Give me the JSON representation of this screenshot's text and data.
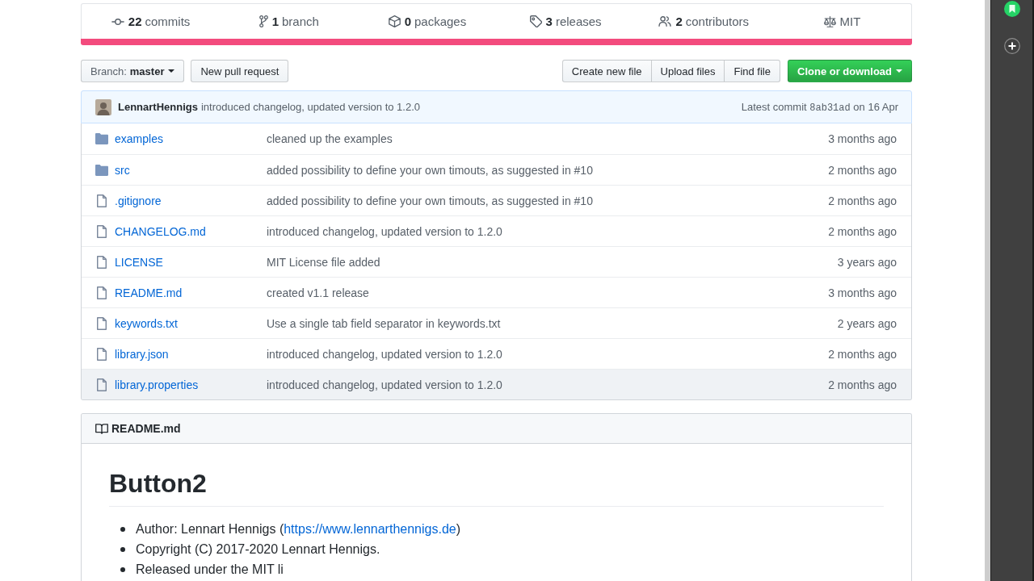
{
  "stats": [
    {
      "kind": "commits",
      "count": "22",
      "label": "commits"
    },
    {
      "kind": "branch",
      "count": "1",
      "label": "branch"
    },
    {
      "kind": "packages",
      "count": "0",
      "label": "packages"
    },
    {
      "kind": "releases",
      "count": "3",
      "label": "releases"
    },
    {
      "kind": "contributors",
      "count": "2",
      "label": "contributors"
    },
    {
      "kind": "license",
      "label": "MIT"
    }
  ],
  "toolbar": {
    "branch_select": {
      "label": "Branch:",
      "value": "master"
    },
    "new_pull_request": "New pull request",
    "file_buttons": [
      "Create new file",
      "Upload files",
      "Find file"
    ],
    "clone_button": "Clone or download"
  },
  "latest_commit": {
    "author": "LennartHennigs",
    "message": "introduced changelog, updated version to 1.2.0",
    "label": "Latest commit",
    "sha": "8ab31ad",
    "date": "on 16 Apr"
  },
  "files": [
    {
      "kind": "folder",
      "name": "examples",
      "message": "cleaned up the examples",
      "age": "3 months ago",
      "hovered": false
    },
    {
      "kind": "folder",
      "name": "src",
      "message": "added possibility to define your own timouts, as suggested in #10",
      "age": "2 months ago",
      "hovered": false
    },
    {
      "kind": "file",
      "name": ".gitignore",
      "message": "added possibility to define your own timouts, as suggested in #10",
      "age": "2 months ago",
      "hovered": false
    },
    {
      "kind": "file",
      "name": "CHANGELOG.md",
      "message": "introduced changelog, updated version to 1.2.0",
      "age": "2 months ago",
      "hovered": false
    },
    {
      "kind": "file",
      "name": "LICENSE",
      "message": "MIT License file added",
      "age": "3 years ago",
      "hovered": false
    },
    {
      "kind": "file",
      "name": "README.md",
      "message": "created v1.1 release",
      "age": "3 months ago",
      "hovered": false
    },
    {
      "kind": "file",
      "name": "keywords.txt",
      "message": "Use a single tab field separator in keywords.txt",
      "age": "2 years ago",
      "hovered": false
    },
    {
      "kind": "file",
      "name": "library.json",
      "message": "introduced changelog, updated version to 1.2.0",
      "age": "2 months ago",
      "hovered": false
    },
    {
      "kind": "file",
      "name": "library.properties",
      "message": "introduced changelog, updated version to 1.2.0",
      "age": "2 months ago",
      "hovered": true
    }
  ],
  "readme": {
    "filename": "README.md",
    "title": "Button2",
    "items": [
      {
        "text": "Author: Lennart Hennigs (",
        "link": "https://www.lennarthennigs.de",
        "after": ")"
      },
      {
        "text": "Copyright (C) 2017-2020 Lennart Hennigs."
      },
      {
        "text": "Released under the MIT li"
      }
    ]
  }
}
